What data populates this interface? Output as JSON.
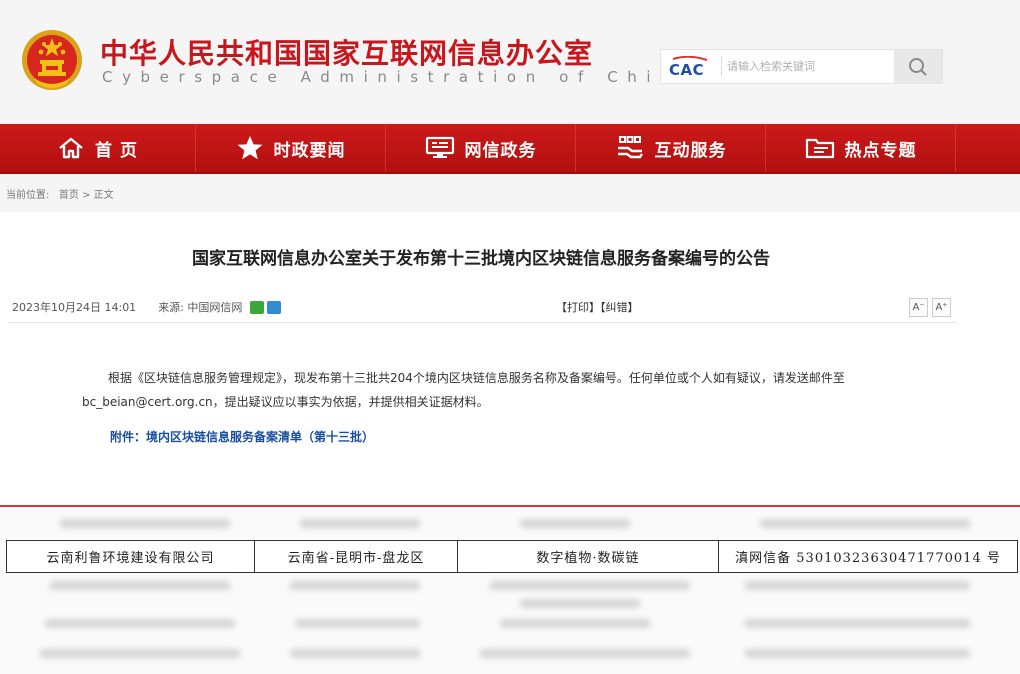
{
  "header": {
    "title_cn": "中华人民共和国国家互联网信息办公室",
    "title_en": "Cyberspace Administration of China",
    "logo_text": "CAC",
    "search": {
      "placeholder": "请输入检索关键词"
    }
  },
  "nav": {
    "items": [
      {
        "label": "首 页",
        "icon": "home-icon"
      },
      {
        "label": "时政要闻",
        "icon": "star-icon"
      },
      {
        "label": "网信政务",
        "icon": "monitor-icon"
      },
      {
        "label": "互动服务",
        "icon": "handshake-icon"
      },
      {
        "label": "热点专题",
        "icon": "folder-icon"
      }
    ]
  },
  "breadcrumb": {
    "prefix": "当前位置:",
    "home": "首页",
    "separator": ">",
    "current": "正文"
  },
  "article": {
    "title": "国家互联网信息办公室关于发布第十三批境内区块链信息服务备案编号的公告",
    "date": "2023年10月24日 14:01",
    "source_label": "来源:",
    "source": "中国网信网",
    "print": "【打印】",
    "correct": "【纠错】",
    "font_small": "A⁻",
    "font_large": "A⁺",
    "body": "根据《区块链信息服务管理规定》，现发布第十三批共204个境内区块链信息服务名称及备案编号。任何单位或个人如有疑议，请发送邮件至bc_beian@cert.org.cn，提出疑议应以事实为依据，并提供相关证据材料。",
    "attachment": "附件：境内区块链信息服务备案清单（第十三批）"
  },
  "table_row": {
    "company": "云南利鲁环境建设有限公司",
    "region": "云南省-昆明市-盘龙区",
    "service": "数字植物·数碳链",
    "record": "滇网信备 53010323630471770014 号"
  },
  "colors": {
    "brand_red": "#c8161d",
    "nav_red": "#be1414",
    "link_blue": "#1a4fa0"
  }
}
